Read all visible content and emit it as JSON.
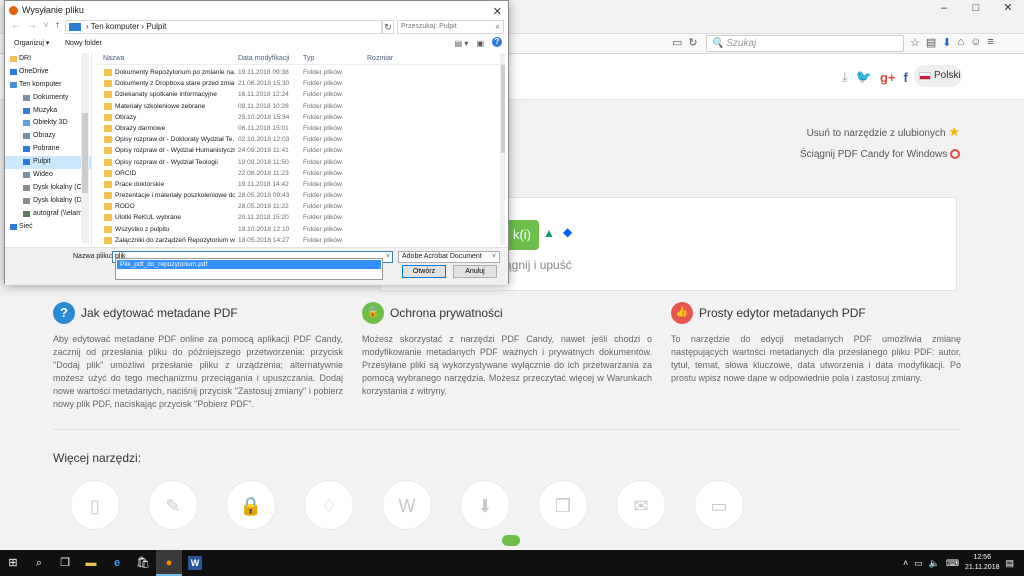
{
  "browser": {
    "search_placeholder": "Szukaj",
    "window_controls": [
      "–",
      "□",
      "✕"
    ],
    "tool_glyphs": [
      "☆",
      "▤",
      "⬇",
      "⌂",
      "☺",
      "≡"
    ]
  },
  "page": {
    "language": "Polski",
    "add_to_favorites": "Usuń to narzędzie z ulubionych",
    "download_app": "Ściągnij PDF Candy for Windows",
    "add_button_text": "k(i)",
    "drop_text": "ągnij i upuść",
    "features": [
      {
        "icon": "?",
        "color": "#2b8ad6",
        "title": "Jak edytować metadane PDF",
        "text": "Aby edytować metadane PDF online za pomocą aplikacji PDF Candy, zacznij od przesłania pliku do późniejszego przetworzenia: przycisk \"Dodaj plik\" umożliwi przesłanie pliku z urządzenia; alternatywnie możesz użyć do tego mechanizmu przeciągania i upuszczania. Dodaj nowe wartości metadanych, naciśnij przycisk \"Zastosuj zmiany\" i pobierz nowy plik PDF, naciskając przycisk \"Pobierz PDF\"."
      },
      {
        "icon": "🔒",
        "color": "#6cc04a",
        "title": "Ochrona prywatności",
        "text": "Możesz skorzystać z narzędzi PDF Candy, nawet jeśli chodzi o modyfikowanie metadanych PDF ważnych i prywatnych dokumentów. Przesyłane pliki są wykorzystywane wyłącznie do ich przetwarzania za pomocą wybranego narzędzia. Możesz przeczytać więcej w Warunkach korzystania z witryny."
      },
      {
        "icon": "👍",
        "color": "#e8554e",
        "title": "Prosty edytor metadanych PDF",
        "text": "To narzędzie do edycji metadanych PDF umożliwia zmianę następujących wartości metadanych dla przesłanego pliku PDF: autor, tytuł, temat, słowa kluczowe, data utworzenia i data modyfikacji. Po prostu wpisz nowe dane w odpowiednie pola i zastosuj zmiany."
      }
    ],
    "more_tools_title": "Więcej narzędzi:",
    "tool_glyphs": [
      "▯",
      "✎",
      "🔒",
      "♢",
      "W",
      "⬇",
      "❐",
      "✉",
      "▭"
    ]
  },
  "dialog": {
    "title": "Wysyłanie pliku",
    "close": "✕",
    "breadcrumb": "›  Ten komputer  ›  Pulpit",
    "search_placeholder": "Przeszukaj: Pulpit",
    "organize": "Organizuj ▾",
    "new_folder": "Nowy folder",
    "nav_items": [
      {
        "label": "DRI",
        "indent": false,
        "color": "#f1c24d"
      },
      {
        "label": "OneDrive",
        "indent": false,
        "color": "#2b7bd9"
      },
      {
        "label": "Ten komputer",
        "indent": false,
        "color": "#4a90d9"
      },
      {
        "label": "Dokumenty",
        "indent": true,
        "color": "#7a8fa8"
      },
      {
        "label": "Muzyka",
        "indent": true,
        "color": "#3a7bd5"
      },
      {
        "label": "Obiekty 3D",
        "indent": true,
        "color": "#5aa0e0"
      },
      {
        "label": "Obrazy",
        "indent": true,
        "color": "#7a8fa8"
      },
      {
        "label": "Pobrane",
        "indent": true,
        "color": "#2b7bd9"
      },
      {
        "label": "Pulpit",
        "indent": true,
        "color": "#2b7bd9",
        "selected": true
      },
      {
        "label": "Wideo",
        "indent": true,
        "color": "#7a8fa8"
      },
      {
        "label": "Dysk lokalny (C:)",
        "indent": true,
        "color": "#8c8c8c"
      },
      {
        "label": "Dysk lokalny (D:)",
        "indent": true,
        "color": "#8c8c8c"
      },
      {
        "label": "autograf (\\\\elam",
        "indent": true,
        "color": "#5a7a5a"
      },
      {
        "label": "Sieć",
        "indent": false,
        "color": "#2b7bd9"
      }
    ],
    "columns": {
      "name": "Nazwa",
      "date": "Data modyfikacji",
      "type": "Typ",
      "size": "Rozmiar"
    },
    "files": [
      {
        "name": "Dokumenty Repozytorium po zmianie na...",
        "date": "19.11.2018 09:38",
        "type": "Folder plików"
      },
      {
        "name": "Dokumenty z Dropboxa stare przed zmia...",
        "date": "21.06.2018 15:30",
        "type": "Folder plików"
      },
      {
        "name": "Dziekanaty spotkanie informacyjne",
        "date": "16.11.2018 12:24",
        "type": "Folder plików"
      },
      {
        "name": "Materiały szkoleniowe zebrane",
        "date": "09.11.2018 10:28",
        "type": "Folder plików"
      },
      {
        "name": "Obrazy",
        "date": "25.10.2018 15:34",
        "type": "Folder plików"
      },
      {
        "name": "Obrazy darmowe",
        "date": "06.11.2018 15:01",
        "type": "Folder plików"
      },
      {
        "name": "Opisy rozpraw dr - Doktoraty Wydział Te...",
        "date": "02.10.2018 12:03",
        "type": "Folder plików"
      },
      {
        "name": "Opisy rozpraw dr - Wydział Humanistyczny",
        "date": "24.09.2018 11:41",
        "type": "Folder plików"
      },
      {
        "name": "Opisy rozpraw dr - Wydział Teologii",
        "date": "19.09.2018 11:50",
        "type": "Folder plików"
      },
      {
        "name": "ORCID",
        "date": "22.08.2018 11:23",
        "type": "Folder plików"
      },
      {
        "name": "Prace doktorskie",
        "date": "19.11.2018 14:42",
        "type": "Folder plików"
      },
      {
        "name": "Prezentacje i materiały poszkoleniowe do...",
        "date": "28.05.2018 09:43",
        "type": "Folder plików"
      },
      {
        "name": "RODO",
        "date": "28.05.2018 11:22",
        "type": "Folder plików"
      },
      {
        "name": "Ulotki ReKUL wybrane",
        "date": "20.11.2018 15:20",
        "type": "Folder plików"
      },
      {
        "name": "Wszystko z pulpitu",
        "date": "19.10.2018 12:10",
        "type": "Folder plików"
      },
      {
        "name": "Załączniki do zarządzeń Repozytorium w...",
        "date": "18.05.2018 14:27",
        "type": "Folder plików"
      }
    ],
    "filename_label": "Nazwa pliku:",
    "filename_value": "plik",
    "suggestion": "Plik_pdf_do_repozytorium.pdf",
    "filter": "Adobe Acrobat Document",
    "open_label": "Otwórz",
    "cancel_label": "Anuluj"
  },
  "taskbar": {
    "time": "12:56",
    "date": "21.11.2018"
  }
}
